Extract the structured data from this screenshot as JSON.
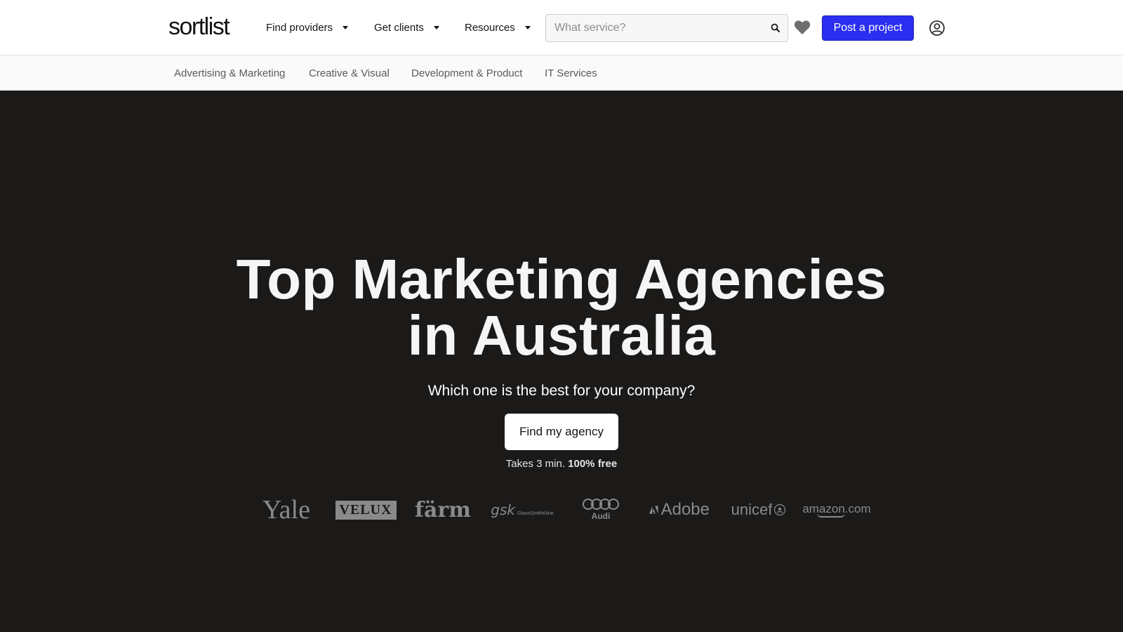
{
  "header": {
    "logo": "sortlist",
    "nav": [
      {
        "label": "Find providers"
      },
      {
        "label": "Get clients"
      },
      {
        "label": "Resources"
      }
    ],
    "search_placeholder": "What service?",
    "post_button": "Post a project"
  },
  "categories": [
    "Advertising & Marketing",
    "Creative & Visual",
    "Development & Product",
    "IT Services"
  ],
  "hero": {
    "title_line1": "Top Marketing Agencies",
    "title_line2": "in Australia",
    "subtitle": "Which one is the best for your company?",
    "cta": "Find my agency",
    "note_prefix": "Takes 3 min.",
    "note_bold": "100% free"
  },
  "client_logos": {
    "yale": "Yale",
    "velux": "VELUX",
    "farm": "färm",
    "gsk": "gsk",
    "gsk_sub": "GlaxoSmithKline",
    "audi": "Audi",
    "adobe": "Adobe",
    "unicef": "unicef",
    "amazon": "amazon.com"
  },
  "colors": {
    "accent": "#2b2ff0",
    "hero_bg": "#1b1a19",
    "logo_gray": "#8a8a8a"
  },
  "icons": {
    "search": "search-icon",
    "heart": "heart-icon",
    "user": "user-icon",
    "caret": "caret-down-icon"
  }
}
